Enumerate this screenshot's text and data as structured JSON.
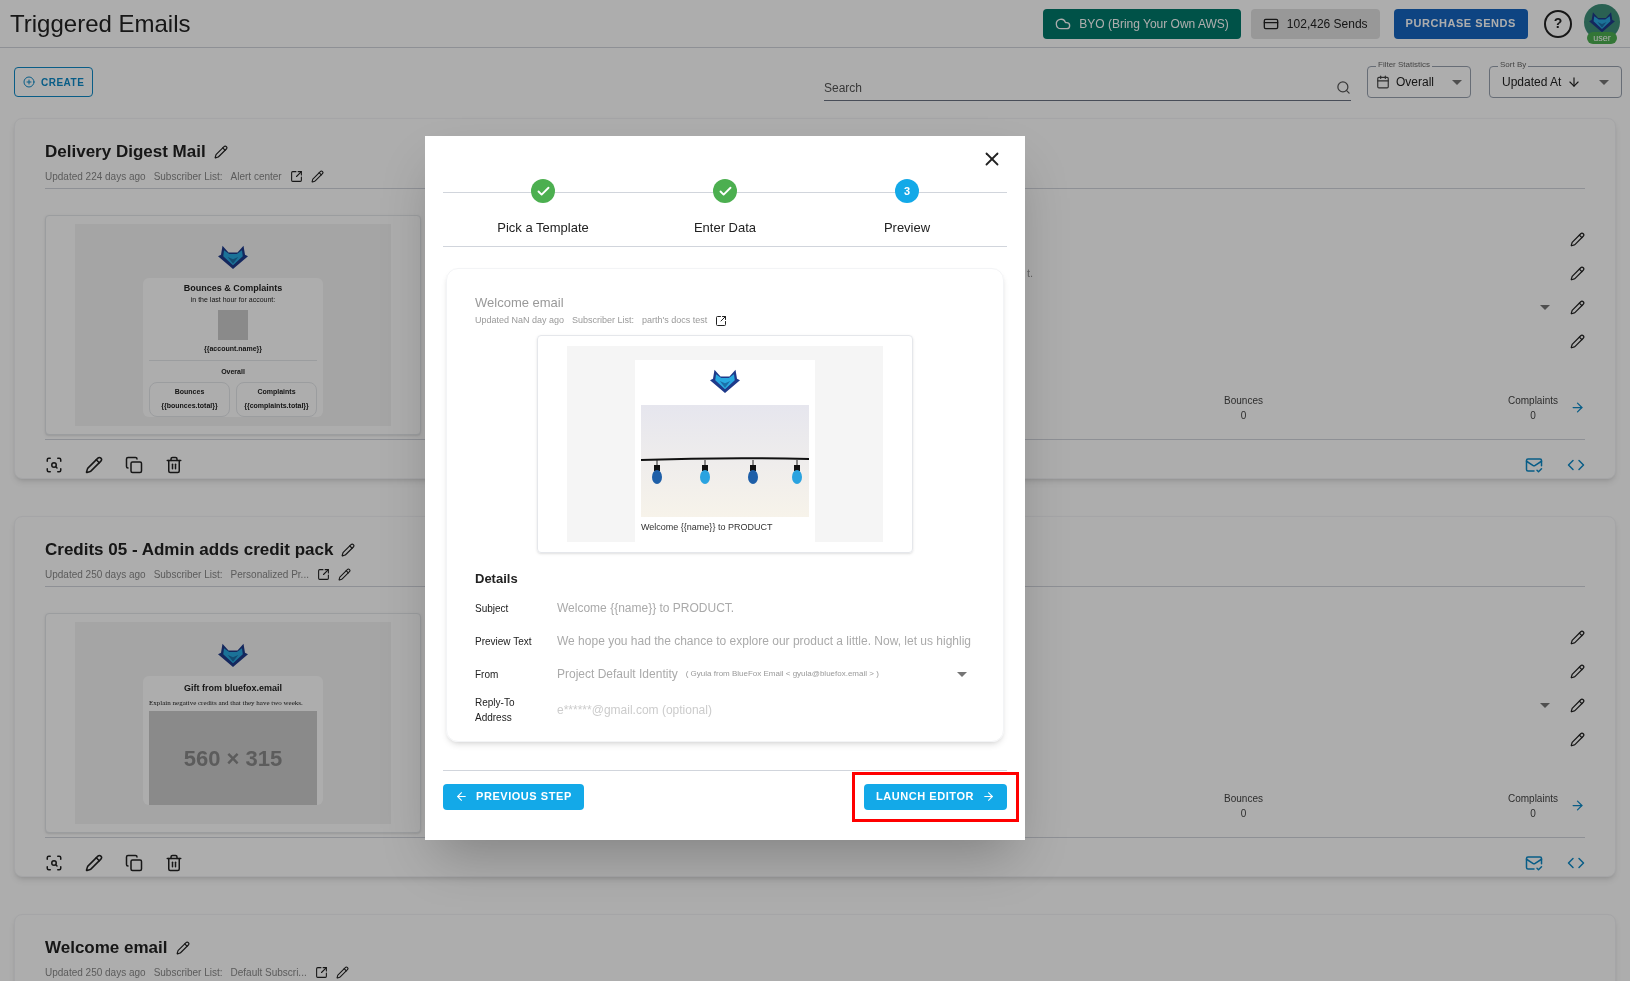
{
  "header": {
    "title": "Triggered Emails",
    "byo_button": "BYO (Bring Your Own AWS)",
    "sends": "102,426 Sends",
    "purchase_button": "PURCHASE SENDS",
    "help_button": "?",
    "avatar_badge": "user"
  },
  "toolbar": {
    "create_button": "CREATE",
    "search": {
      "placeholder": "Search"
    },
    "filter": {
      "label": "Filter Statistics",
      "value": "Overall"
    },
    "sort": {
      "label": "Sort By",
      "value": "Updated At"
    }
  },
  "cards": [
    {
      "title": "Delivery Digest Mail",
      "updated": "Updated 224 days ago",
      "subscriber_label": "Subscriber List:",
      "subscriber_list": "Alert center",
      "fragment": "t.",
      "preview": {
        "kind": "digest",
        "heading": "Bounces & Complaints",
        "subheading": "in the last hour for account:",
        "account": "{{account.name}}",
        "overall": "Overall",
        "stats": [
          {
            "label": "Bounces",
            "value": "{{bounces.total}}"
          },
          {
            "label": "Complaints",
            "value": "{{complaints.total}}"
          }
        ]
      },
      "stats": [
        {
          "label": "Bounces",
          "value": "0"
        },
        {
          "label": "Complaints",
          "value": "0"
        }
      ]
    },
    {
      "title": "Credits 05 - Admin adds credit pack",
      "updated": "Updated 250 days ago",
      "subscriber_label": "Subscriber List:",
      "subscriber_list": "Personalized Pr...",
      "preview": {
        "kind": "gift",
        "heading": "Gift from bluefox.email",
        "body": "Explain negative credits and that they have two weeks.",
        "image_text": "560 × 315"
      },
      "stats": [
        {
          "label": "Bounces",
          "value": "0"
        },
        {
          "label": "Complaints",
          "value": "0"
        }
      ]
    },
    {
      "title": "Welcome email",
      "updated": "Updated 250 days ago",
      "subscriber_label": "Subscriber List:",
      "subscriber_list": "Default Subscri..."
    }
  ],
  "modal": {
    "steps": [
      {
        "label": "Pick a Template",
        "completed": true
      },
      {
        "label": "Enter Data",
        "completed": true
      },
      {
        "label": "Preview",
        "completed": false,
        "number": "3"
      }
    ],
    "email_name": "Welcome email",
    "updated": "Updated NaN day ago",
    "subscriber_label": "Subscriber List:",
    "subscriber_list": "parth's docs test",
    "caption": "Welcome {{name}} to PRODUCT",
    "details_title": "Details",
    "details": [
      {
        "kind": "text",
        "label": "Subject",
        "value": "Welcome {{name}} to PRODUCT."
      },
      {
        "kind": "text",
        "label": "Preview Text",
        "value": "We hope you had the chance to explore our product a little. Now, let us highlig"
      },
      {
        "kind": "select",
        "label": "From",
        "value": "Project Default Identity",
        "note": "( Gyula from BlueFox Email < gyula@bluefox.email > )"
      },
      {
        "kind": "input",
        "label": "Reply-To Address",
        "placeholder": "e******@gmail.com (optional)"
      }
    ],
    "previous_button": "PREVIOUS STEP",
    "launch_button": {
      "label": "LAUNCH EDITOR",
      "highlighted": true
    }
  }
}
